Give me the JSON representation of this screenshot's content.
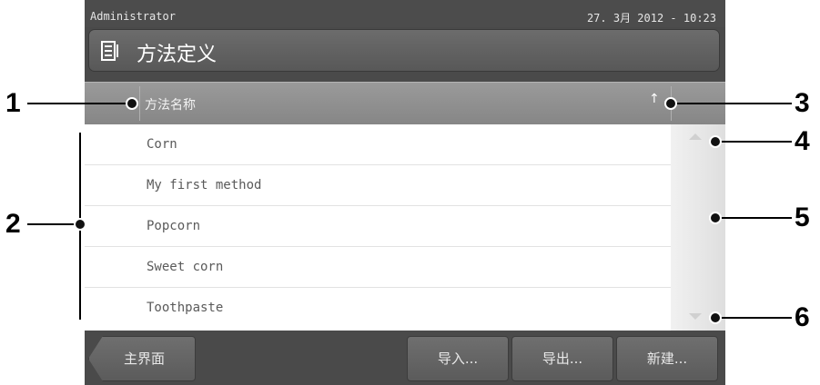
{
  "status": {
    "user": "Administrator",
    "datetime": "27. 3月 2012 - 10:23"
  },
  "title": {
    "icon": "method-list-icon",
    "text": "方法定义"
  },
  "table": {
    "column_header": "方法名称",
    "sort_indicator": "↑",
    "rows": [
      "Corn",
      "My first method",
      "Popcorn",
      "Sweet corn",
      "Toothpaste"
    ]
  },
  "buttons": {
    "home": "主界面",
    "import": "导入...",
    "export": "导出...",
    "new": "新建..."
  },
  "callouts": [
    "1",
    "2",
    "3",
    "4",
    "5",
    "6"
  ]
}
